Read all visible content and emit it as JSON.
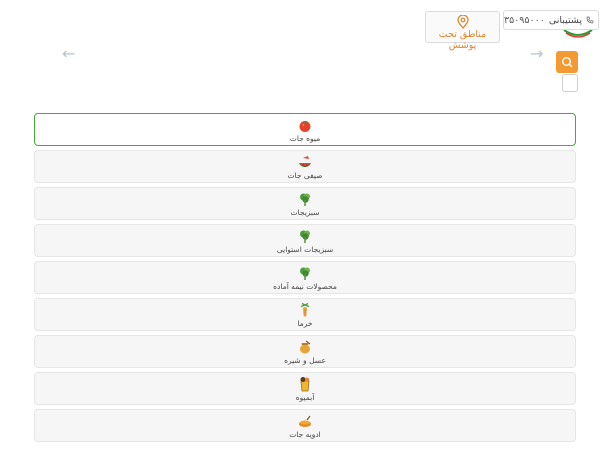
{
  "header": {
    "support": {
      "label": "پشتیبانی",
      "number": "۳۵۰۹۵۰۰۰",
      "icon": "phone-icon"
    },
    "area": {
      "label": "مناطق تحت پوشش",
      "icon": "location-pin-icon",
      "color": "#e0842a"
    },
    "search": {
      "icon": "search-icon",
      "color": "#f39a32"
    }
  },
  "categories": [
    {
      "label": "میوه جات",
      "icon": "tomato-icon",
      "active": true
    },
    {
      "label": "صیفی جات",
      "icon": "watermelon-icon"
    },
    {
      "label": "سبزیجات",
      "icon": "leafy-greens-icon"
    },
    {
      "label": "سبزیجات استوایی",
      "icon": "leafy-greens-icon"
    },
    {
      "label": "محصولات نیمه آماده",
      "icon": "leafy-greens-icon"
    },
    {
      "label": "خرما",
      "icon": "date-palm-icon"
    },
    {
      "label": "عسل و شیره",
      "icon": "honey-pot-icon"
    },
    {
      "label": "آبمیوه",
      "icon": "juice-icon"
    },
    {
      "label": "ادویه جات",
      "icon": "spice-icon"
    }
  ],
  "colors": {
    "active_border": "#4aa83d",
    "accent": "#f39a32"
  }
}
